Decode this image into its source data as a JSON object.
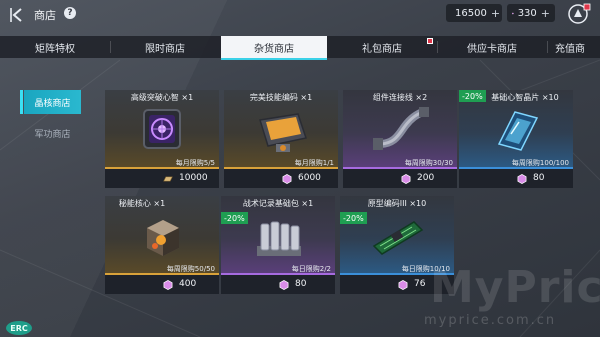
{
  "header": {
    "title": "商店",
    "help": "?",
    "currencies": [
      {
        "name": "gold-bar",
        "value": "16500",
        "plus": "+"
      },
      {
        "name": "crystal",
        "value": "330",
        "plus": "+"
      }
    ]
  },
  "tabs": [
    {
      "label": "矩阵特权",
      "active": false
    },
    {
      "label": "限时商店",
      "active": false
    },
    {
      "label": "杂货商店",
      "active": true
    },
    {
      "label": "礼包商店",
      "active": false,
      "badge": true
    },
    {
      "label": "供应卡商店",
      "active": false
    },
    {
      "label": "充值商",
      "active": false
    }
  ],
  "side_nav": [
    {
      "label": "晶核商店",
      "active": true
    },
    {
      "label": "军功商店",
      "active": false
    }
  ],
  "items": [
    {
      "title": "高级突破心智 ×1",
      "limit": "每月限购5/5",
      "price": "10000",
      "price_icon": "gold-bar-icon",
      "rarity": "gold",
      "discount": ""
    },
    {
      "title": "完美技能编码 ×1",
      "limit": "每月限购1/1",
      "price": "6000",
      "price_icon": "crystal-icon",
      "rarity": "gold",
      "discount": ""
    },
    {
      "title": "组件连接线 ×2",
      "limit": "每周限购30/30",
      "price": "200",
      "price_icon": "crystal-icon",
      "rarity": "purple",
      "discount": ""
    },
    {
      "title": "基础心智晶片 ×10",
      "limit": "每周限购100/100",
      "price": "80",
      "price_icon": "crystal-icon",
      "rarity": "blue",
      "discount": "-20%"
    },
    {
      "title": "秘能核心 ×1",
      "limit": "每周限购50/50",
      "price": "400",
      "price_icon": "crystal-icon",
      "rarity": "gold",
      "discount": ""
    },
    {
      "title": "战术记录基础包 ×1",
      "limit": "每日限购2/2",
      "price": "80",
      "price_icon": "crystal-icon",
      "rarity": "purple",
      "discount": "-20%"
    },
    {
      "title": "原型编码III ×10",
      "limit": "每日限购10/10",
      "price": "76",
      "price_icon": "crystal-icon",
      "rarity": "blue",
      "discount": "-20%"
    }
  ],
  "watermark": {
    "main": "MyPrice",
    "sub": "myprice.com.cn"
  },
  "logo_text": "ERC",
  "colors": {
    "accent": "#2ab8cf",
    "discount": "#1f9e52",
    "gold": "#d9a23a",
    "purple": "#a66be0",
    "blue": "#3b8fd9"
  }
}
